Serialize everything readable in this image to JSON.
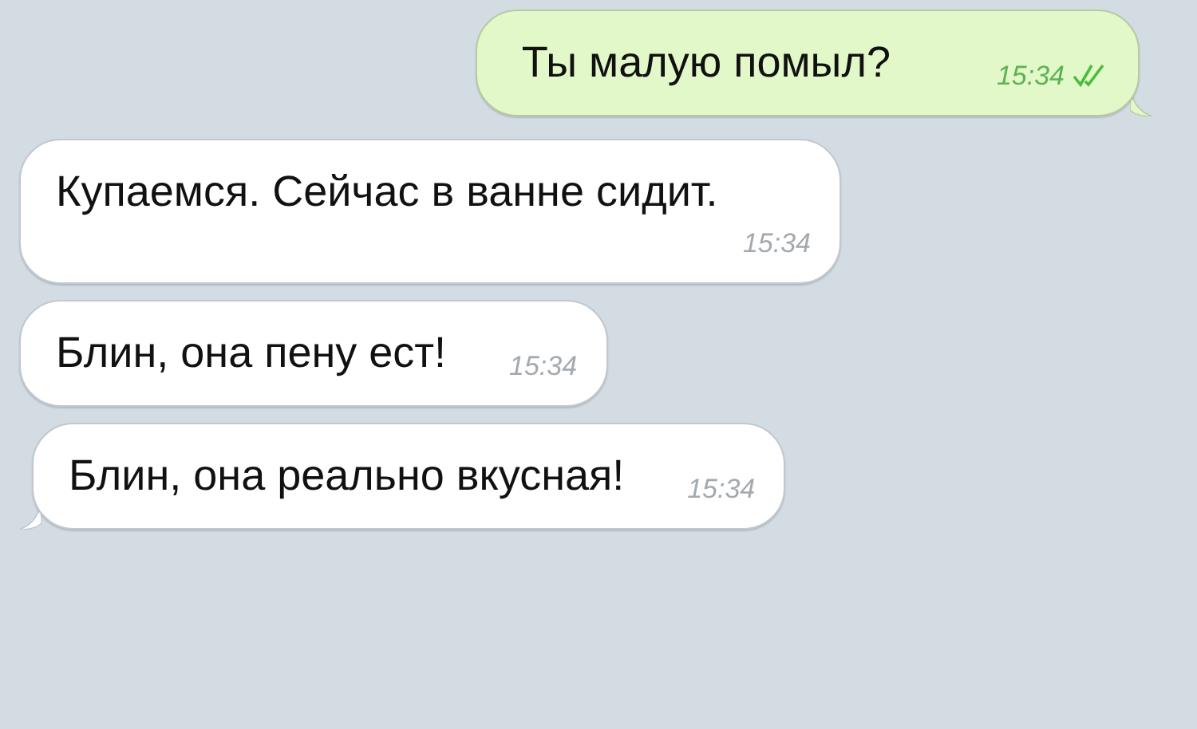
{
  "messages": [
    {
      "text": "Ты малую помыл?",
      "time": "15:34",
      "outgoing": true,
      "read": true,
      "tail": true
    },
    {
      "text": "Купаемся. Сейчас в ванне сидит.",
      "time": "15:34",
      "outgoing": false,
      "tail": false
    },
    {
      "text": "Блин, она пену ест!",
      "time": "15:34",
      "outgoing": false,
      "tail": false
    },
    {
      "text": "Блин, она реально вкусная!",
      "time": "15:34",
      "outgoing": false,
      "tail": true
    }
  ]
}
